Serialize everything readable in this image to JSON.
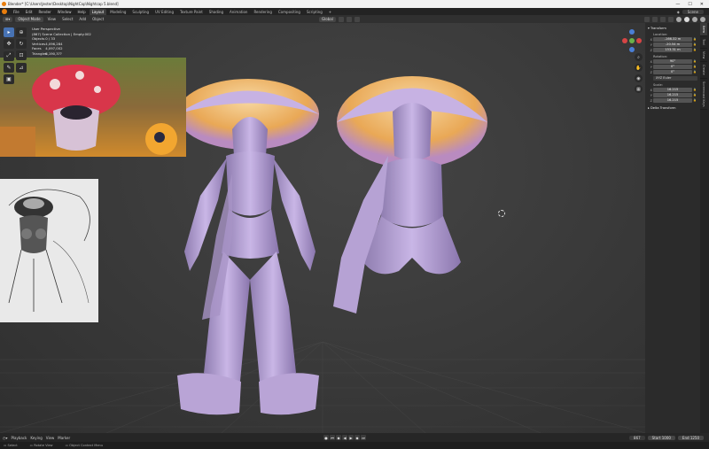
{
  "window": {
    "title": "Blender* [C:\\Users\\Jester\\Desktop\\NightCap\\Nightcap 5.blend]",
    "controls": [
      "—",
      "☐",
      "✕"
    ]
  },
  "menu": {
    "items": [
      "File",
      "Edit",
      "Render",
      "Window",
      "Help"
    ],
    "workspaces": [
      "Layout",
      "Modeling",
      "Sculpting",
      "UV Editing",
      "Texture Paint",
      "Shading",
      "Animation",
      "Rendering",
      "Compositing",
      "Scripting",
      "+"
    ],
    "active_workspace": "Layout",
    "scene_label": "Scene"
  },
  "header": {
    "mode": "Object Mode",
    "menus": [
      "View",
      "Select",
      "Add",
      "Object"
    ],
    "orientation": "Global"
  },
  "viewport": {
    "info": {
      "view": "User Perspective",
      "collection": "(867) Scene Collection | Empty.002",
      "objects_label": "Objects",
      "objects_value": "0 / 33",
      "vertices_label": "Vertices",
      "vertices_value": "4,096,284",
      "faces_label": "Faces",
      "faces_value": "4,097,002",
      "triangles_label": "Triangles",
      "triangles_value": "8,190,3??"
    }
  },
  "npanel": {
    "section": "Transform",
    "location_label": "Location:",
    "location": [
      "-166.32 m",
      "-20.54 m",
      "153.31 m"
    ],
    "rotation_label": "Rotation:",
    "rotation": [
      "90°",
      "0°",
      "0°"
    ],
    "rotation_mode": "XYZ Euler",
    "scale_label": "Scale:",
    "scale": [
      "16.215",
      "16.215",
      "16.215"
    ],
    "delta_label": "Delta Transform",
    "axes": [
      "X",
      "Y",
      "Z"
    ],
    "side_tabs": [
      "Item",
      "Tool",
      "View",
      "Create",
      "Screencast Keys"
    ]
  },
  "timeline": {
    "menus": [
      "Playback",
      "Keying",
      "View",
      "Marker"
    ],
    "current_frame": "867",
    "start_label": "Start",
    "start": "1000",
    "end_label": "End",
    "end": "1250"
  },
  "status": {
    "items": [
      "Select",
      "Rotate View",
      "Object Context Menu"
    ]
  },
  "colors": {
    "accent": "#4772b3",
    "viewport_bg": "#3d3d3d",
    "figure_skin": "#b9a4d6",
    "figure_rim": "#f0b45a"
  }
}
